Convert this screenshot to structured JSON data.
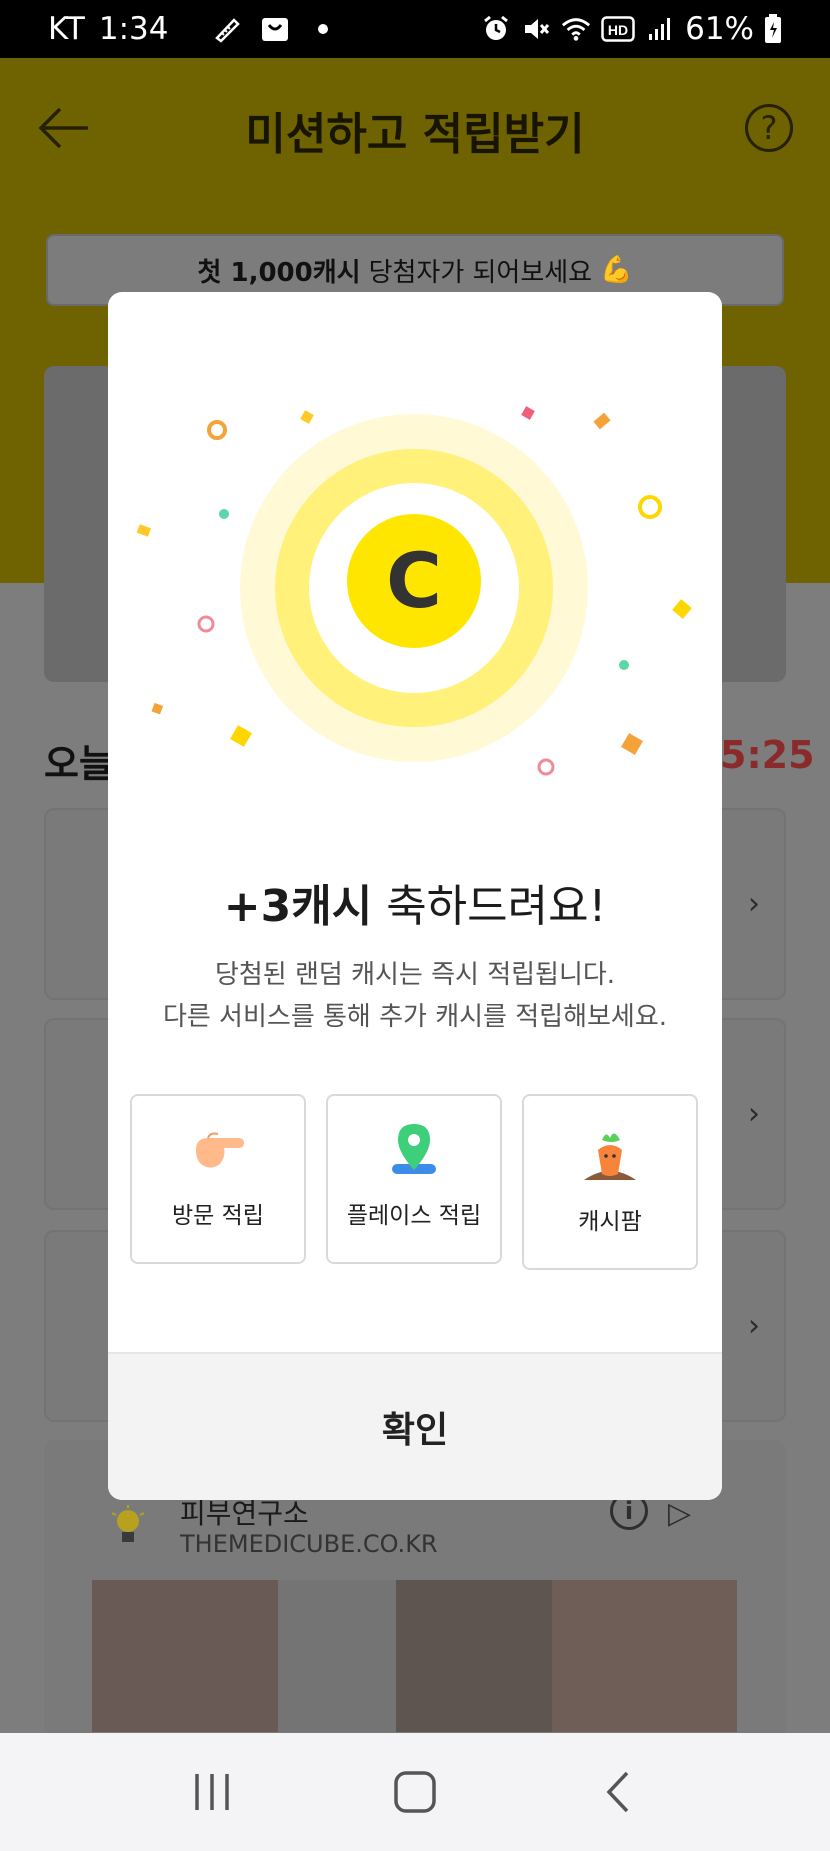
{
  "status_bar": {
    "carrier": "KT",
    "time": "1:34",
    "battery": "61%",
    "hd_label": "HD",
    "icons": [
      "pen-icon",
      "shopping-bag-icon",
      "dot-icon",
      "alarm-icon",
      "mute-icon",
      "wifi-icon",
      "hd-icon",
      "signal-icon",
      "battery-icon"
    ]
  },
  "header": {
    "title": "미션하고 적립받기",
    "back_icon": "arrow-left-icon",
    "help_icon": "question-circle-icon",
    "help_glyph": "?"
  },
  "promo_banner": {
    "bold": "첫 1,000캐시",
    "rest": "당첨자가 되어보세요",
    "emoji": "💪"
  },
  "background": {
    "today_label": "오늘",
    "timer": "5:25",
    "chevron": "›",
    "ad_title": "피부연구소",
    "ad_url": "THEMEDICUBE.CO.KR",
    "ad_info_glyph": "i",
    "ad_play_glyph": "▷"
  },
  "modal": {
    "title_bold": "+3캐시",
    "title_rest": "축하드려요!",
    "desc_line1": "당첨된 랜덤 캐시는 즉시 적립됩니다.",
    "desc_line2": "다른 서비스를 통해 추가 캐시를 적립해보세요.",
    "coin_letter": "C",
    "options": [
      {
        "label": "방문 적립",
        "icon": "pointing-hand-icon"
      },
      {
        "label": "플레이스 적립",
        "icon": "location-pin-icon"
      },
      {
        "label": "캐시팜",
        "icon": "carrot-icon"
      }
    ],
    "confirm_label": "확인"
  },
  "colors": {
    "accent_yellow": "#ffe600",
    "coin_dark": "#3a3a3a",
    "overlay_header": "#6e6300",
    "modal_bg": "#ffffff"
  }
}
